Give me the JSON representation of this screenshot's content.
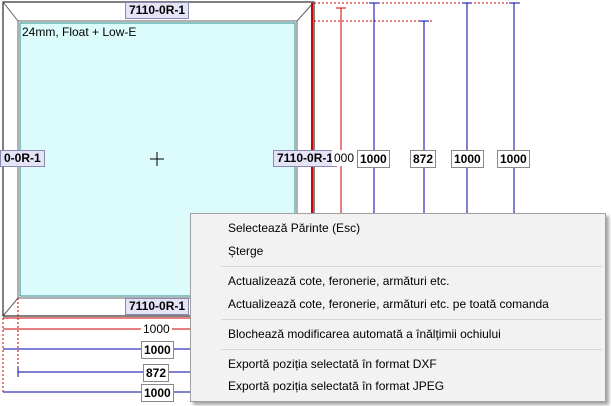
{
  "window": {
    "profile_top": "7110-0R-1",
    "profile_bottom": "7110-0R-1",
    "profile_left": "0-0R-1",
    "profile_right": "7110-0R-1",
    "glass": "24mm, Float + Low-E"
  },
  "dimensions": {
    "vertical": [
      "000",
      "1000",
      "872",
      "1000",
      "1000"
    ],
    "horizontal": [
      "1000",
      "1000",
      "872",
      "1000"
    ]
  },
  "context_menu": {
    "items": [
      "Selectează Părinte (Esc)",
      "Șterge",
      "Actualizează cote, feronerie, armături etc.",
      "Actualizează cote, feronerie, armături etc. pe toată comanda",
      "Blochează modificarea automată a înălțimii ochiului",
      "Exportă poziția selectată în format DXF",
      "Exportă poziția selectată în format JPEG"
    ]
  },
  "colors": {
    "glass_fill": "#dcfcfc",
    "frame": "#000000",
    "dimension_blue": "#0000aa",
    "dimension_red": "#cc0000",
    "menu_bg": "#f2f2f2"
  }
}
